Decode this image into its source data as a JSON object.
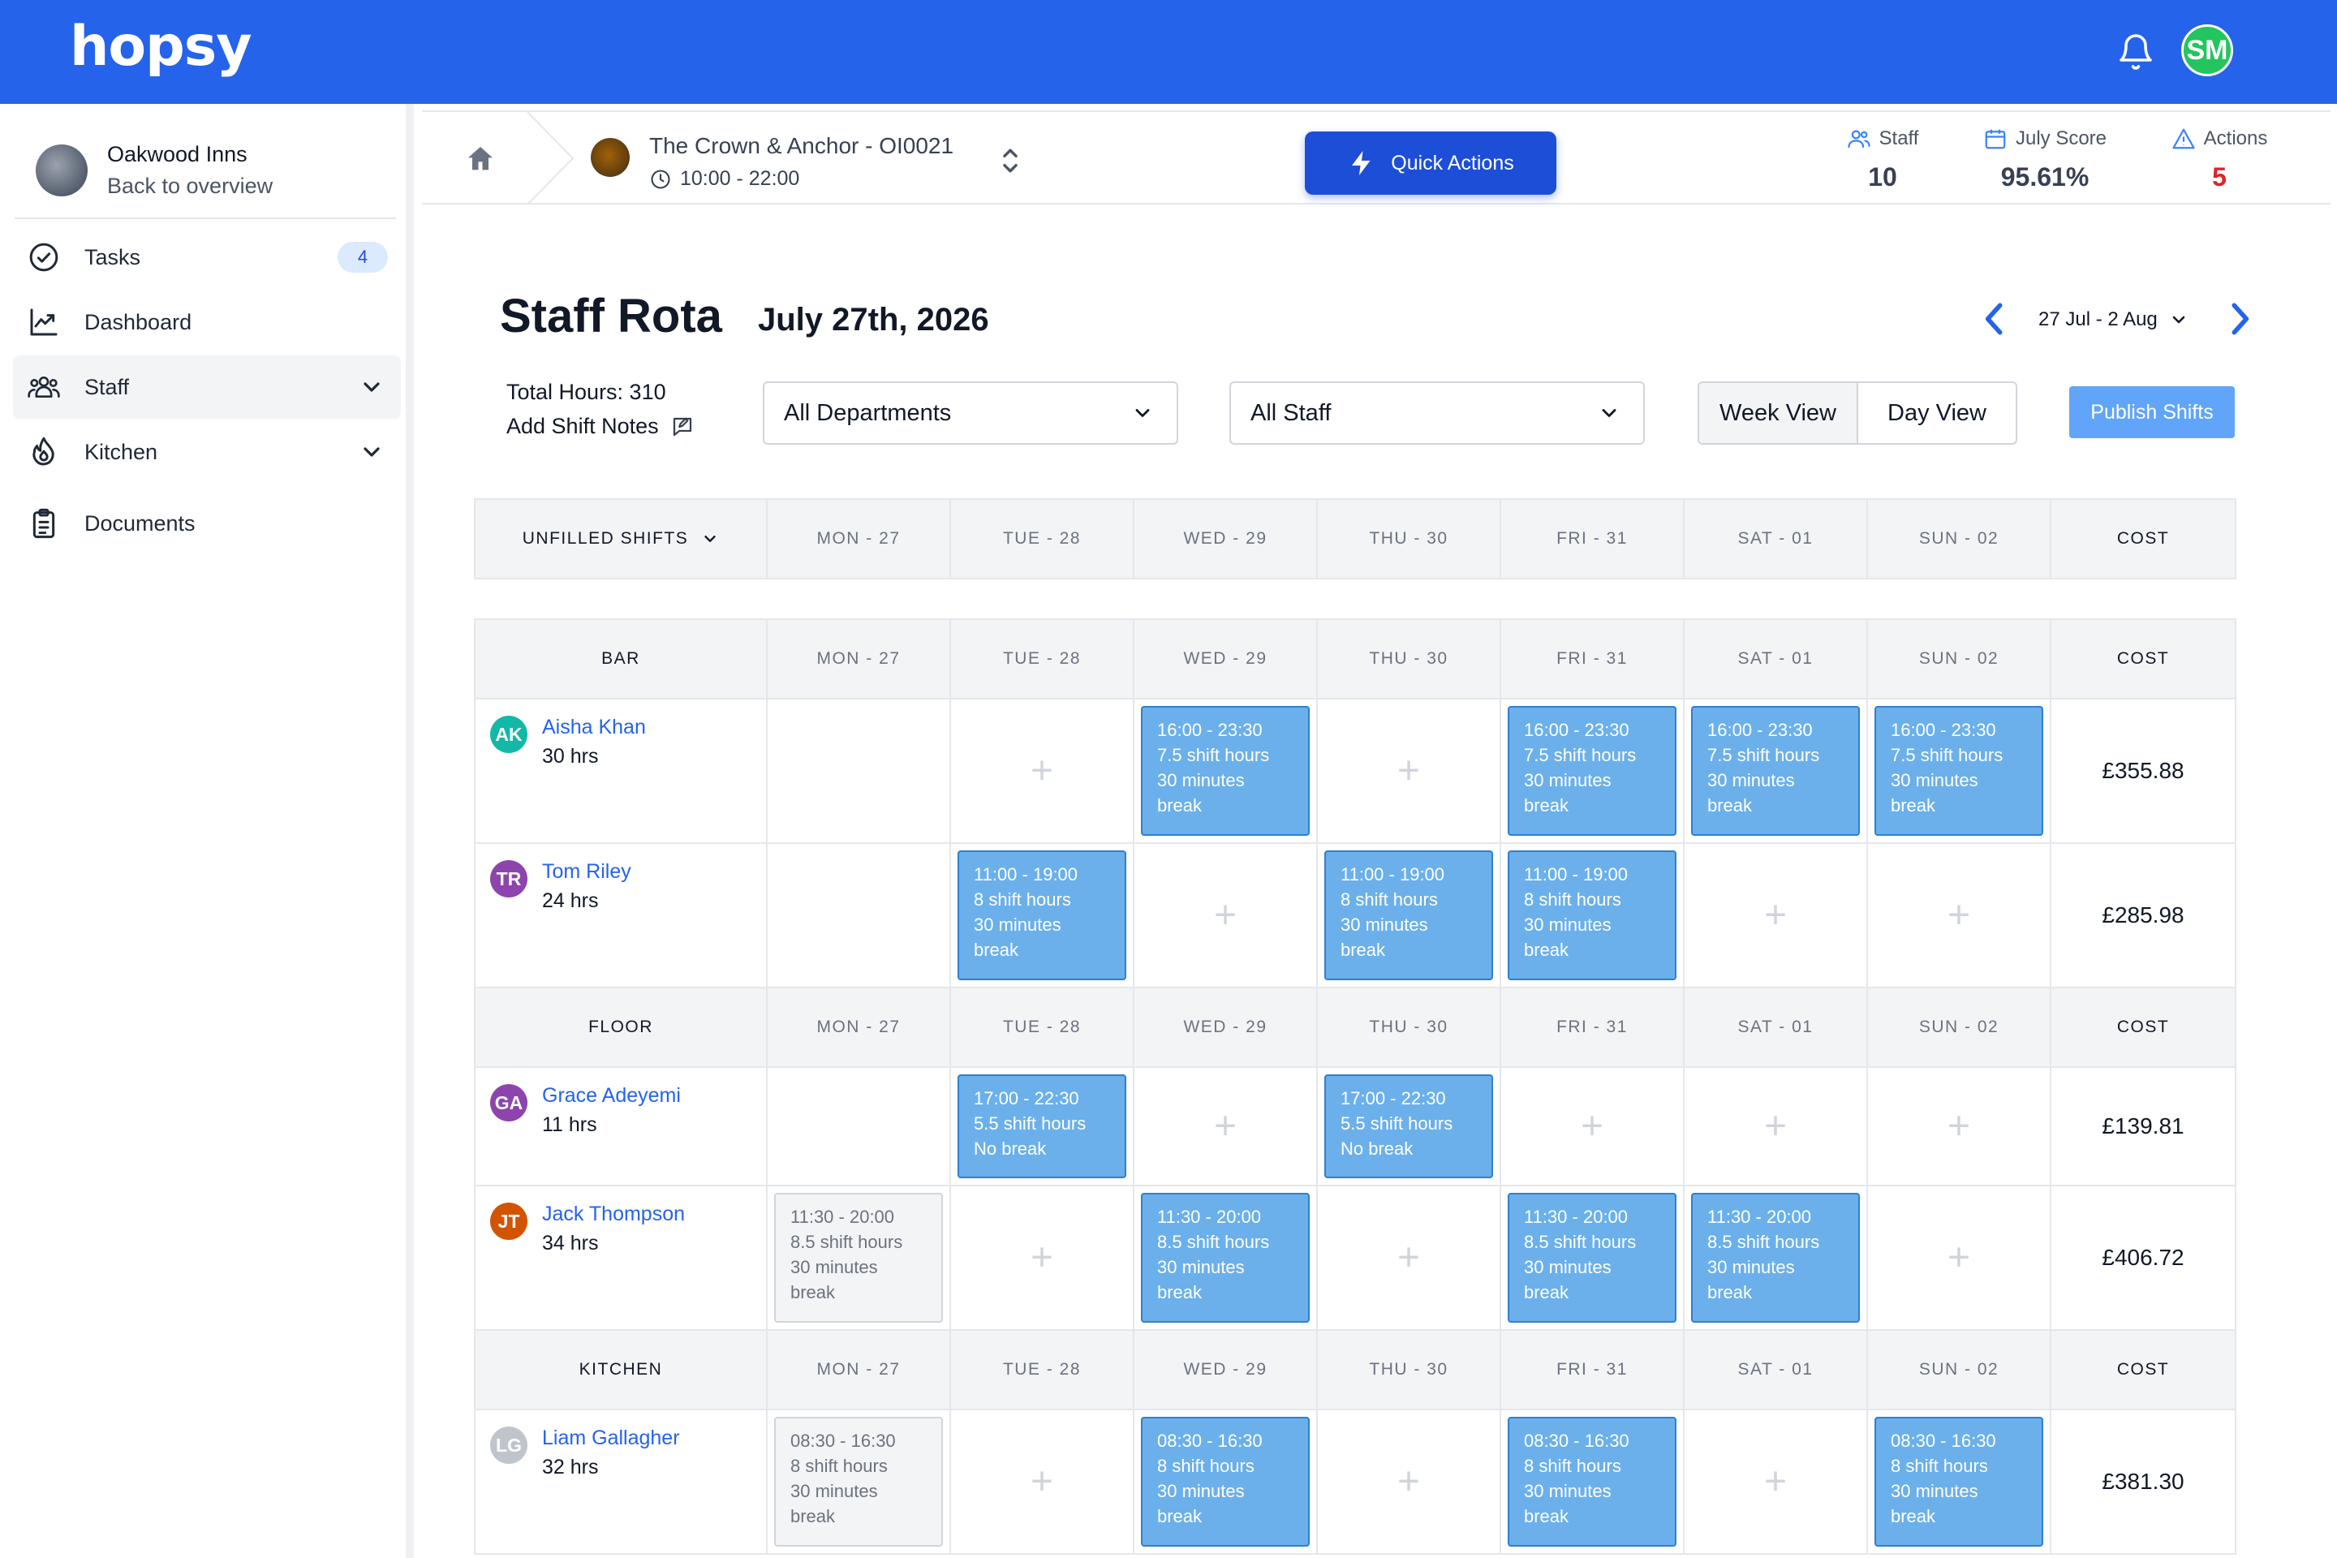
{
  "brand": "hopsy",
  "user_initials": "SM",
  "org": {
    "name": "Oakwood Inns",
    "back": "Back to overview"
  },
  "nav": {
    "tasks": {
      "label": "Tasks",
      "badge": "4"
    },
    "dashboard": {
      "label": "Dashboard"
    },
    "staff": {
      "label": "Staff"
    },
    "kitchen": {
      "label": "Kitchen"
    },
    "documents": {
      "label": "Documents"
    }
  },
  "venue": {
    "name": "The Crown & Anchor - OI0021",
    "hours": "10:00 - 22:00"
  },
  "quick_actions": "Quick Actions",
  "stats": {
    "staff": {
      "label": "Staff",
      "value": "10"
    },
    "score": {
      "label": "July Score",
      "value": "95.61%"
    },
    "actions": {
      "label": "Actions",
      "value": "5"
    }
  },
  "page": {
    "title": "Staff Rota",
    "date": "July 27th, 2026",
    "range": "27 Jul - 2 Aug"
  },
  "controls": {
    "total_hours": "Total Hours: 310",
    "add_notes": "Add Shift Notes",
    "department": "All Departments",
    "staff": "All Staff",
    "week_view": "Week View",
    "day_view": "Day View",
    "publish": "Publish Shifts"
  },
  "days": [
    "MON - 27",
    "TUE - 28",
    "WED - 29",
    "THU - 30",
    "FRI - 31",
    "SAT - 01",
    "SUN - 02"
  ],
  "cost_label": "COST",
  "unfilled_label": "UNFILLED SHIFTS",
  "sections": [
    {
      "name": "BAR",
      "employees": [
        {
          "initials": "AK",
          "color": "#14b8a6",
          "name": "Aisha Khan",
          "hours": "30 hrs",
          "cost": "£355.88",
          "shifts": [
            null,
            "plus",
            {
              "time": "16:00 - 23:30",
              "len": "7.5 shift hours",
              "brk1": "30 minutes",
              "brk2": "break"
            },
            "plus",
            {
              "time": "16:00 - 23:30",
              "len": "7.5 shift hours",
              "brk1": "30 minutes",
              "brk2": "break"
            },
            {
              "time": "16:00 - 23:30",
              "len": "7.5 shift hours",
              "brk1": "30 minutes",
              "brk2": "break"
            },
            {
              "time": "16:00 - 23:30",
              "len": "7.5 shift hours",
              "brk1": "30 minutes",
              "brk2": "break"
            }
          ]
        },
        {
          "initials": "TR",
          "color": "#8e44ad",
          "name": "Tom Riley",
          "hours": "24 hrs",
          "cost": "£285.98",
          "shifts": [
            null,
            {
              "time": "11:00 - 19:00",
              "len": "8 shift hours",
              "brk1": "30 minutes",
              "brk2": "break"
            },
            "plus",
            {
              "time": "11:00 - 19:00",
              "len": "8 shift hours",
              "brk1": "30 minutes",
              "brk2": "break"
            },
            {
              "time": "11:00 - 19:00",
              "len": "8 shift hours",
              "brk1": "30 minutes",
              "brk2": "break"
            },
            "plus",
            "plus"
          ]
        }
      ]
    },
    {
      "name": "FLOOR",
      "employees": [
        {
          "initials": "GA",
          "color": "#8e44ad",
          "name": "Grace Adeyemi",
          "hours": "11 hrs",
          "cost": "£139.81",
          "shifts": [
            null,
            {
              "time": "17:00 - 22:30",
              "len": "5.5 shift hours",
              "brk1": "No break",
              "brk2": ""
            },
            "plus",
            {
              "time": "17:00 - 22:30",
              "len": "5.5 shift hours",
              "brk1": "No break",
              "brk2": ""
            },
            "plus",
            "plus",
            "plus"
          ]
        },
        {
          "initials": "JT",
          "color": "#d35400",
          "name": "Jack Thompson",
          "hours": "34 hrs",
          "cost": "£406.72",
          "shifts": [
            {
              "time": "11:30 - 20:00",
              "len": "8.5 shift hours",
              "brk1": "30 minutes",
              "brk2": "break",
              "grey": true
            },
            "plus",
            {
              "time": "11:30 - 20:00",
              "len": "8.5 shift hours",
              "brk1": "30 minutes",
              "brk2": "break"
            },
            "plus",
            {
              "time": "11:30 - 20:00",
              "len": "8.5 shift hours",
              "brk1": "30 minutes",
              "brk2": "break"
            },
            {
              "time": "11:30 - 20:00",
              "len": "8.5 shift hours",
              "brk1": "30 minutes",
              "brk2": "break"
            },
            "plus"
          ]
        }
      ]
    },
    {
      "name": "KITCHEN",
      "employees": [
        {
          "initials": "LG",
          "color": "#c0c4cc",
          "name": "Liam Gallagher",
          "hours": "32 hrs",
          "cost": "£381.30",
          "shifts": [
            {
              "time": "08:30 - 16:30",
              "len": "8 shift hours",
              "brk1": "30 minutes",
              "brk2": "break",
              "grey": true
            },
            "plus",
            {
              "time": "08:30 - 16:30",
              "len": "8 shift hours",
              "brk1": "30 minutes",
              "brk2": "break"
            },
            "plus",
            {
              "time": "08:30 - 16:30",
              "len": "8 shift hours",
              "brk1": "30 minutes",
              "brk2": "break"
            },
            "plus",
            {
              "time": "08:30 - 16:30",
              "len": "8 shift hours",
              "brk1": "30 minutes",
              "brk2": "break"
            }
          ]
        }
      ]
    }
  ]
}
